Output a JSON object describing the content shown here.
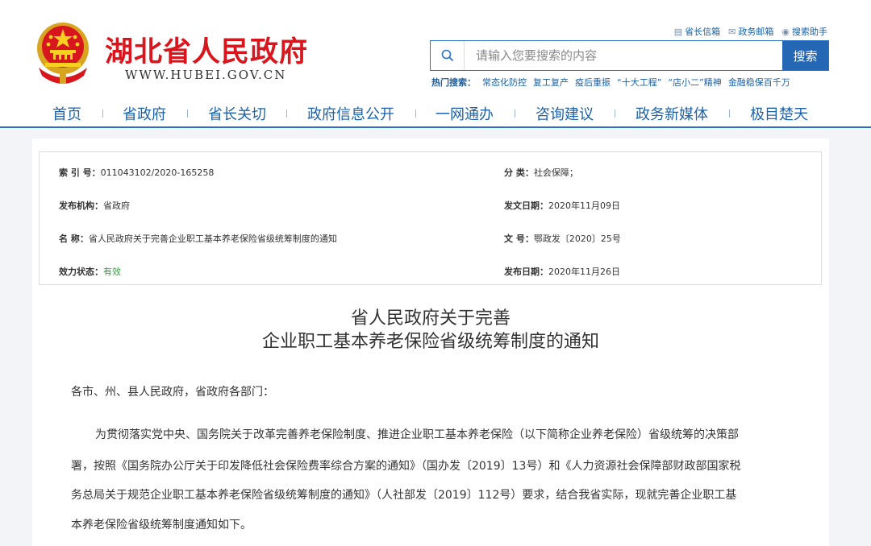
{
  "header": {
    "site_title": "湖北省人民政府",
    "site_url": "WWW.HUBEI.GOV.CN",
    "top_links": [
      {
        "icon": "mailbox-icon",
        "label": "省长信箱"
      },
      {
        "icon": "envelope-icon",
        "label": "政务邮箱"
      },
      {
        "icon": "assistant-icon",
        "label": "搜索助手"
      }
    ],
    "search": {
      "placeholder": "请输入您要搜索的内容",
      "button_label": "搜索"
    },
    "hot_label": "热门搜索：",
    "hot_items": [
      "常态化防控",
      "复工复产",
      "疫后重振",
      "“十大工程”",
      "“店小二”精神",
      "金融稳保百千万"
    ]
  },
  "nav": [
    "首页",
    "省政府",
    "省长关切",
    "政府信息公开",
    "一网通办",
    "咨询建议",
    "政务新媒体",
    "极目楚天"
  ],
  "meta": {
    "index_label": "索 引 号：",
    "index_value": "011043102/2020-165258",
    "category_label": "分 类：",
    "category_value": "社会保障；",
    "publisher_label": "发布机构：",
    "publisher_value": "省政府",
    "issue_date_label": "发文日期：",
    "issue_date_value": "2020年11月09日",
    "name_label": "名 称：",
    "name_value": "省人民政府关于完善企业职工基本养老保险省级统筹制度的通知",
    "doc_no_label": "文 号：",
    "doc_no_value": "鄂政发〔2020〕25号",
    "status_label": "效力状态：",
    "status_value": "有效",
    "publish_date_label": "发布日期：",
    "publish_date_value": "2020年11月26日"
  },
  "document": {
    "title_line1": "省人民政府关于完善",
    "title_line2": "企业职工基本养老保险省级统筹制度的通知",
    "salutation": "各市、州、县人民政府，省政府各部门：",
    "body_lines": [
      "为贯彻落实党中央、国务院关于改革完善养老保险制度、推进企业职工基本养老保险（以下简称企业养老保险）省级统筹的决策部",
      "署，按照《国务院办公厅关于印发降低社会保险费率综合方案的通知》（国办发〔2019〕13号）和《人力资源社会保障部财政部国家税",
      "务总局关于规范企业职工基本养老保险省级统筹制度的通知》（人社部发〔2019〕112号）要求，结合我省实际，现就完善企业职工基",
      "本养老保险省级统筹制度通知如下。"
    ]
  },
  "colors": {
    "brand_red": "#d7161d",
    "link_blue": "#1c62ab",
    "search_button": "#2468b5",
    "valid_green": "#2f9c3a"
  }
}
